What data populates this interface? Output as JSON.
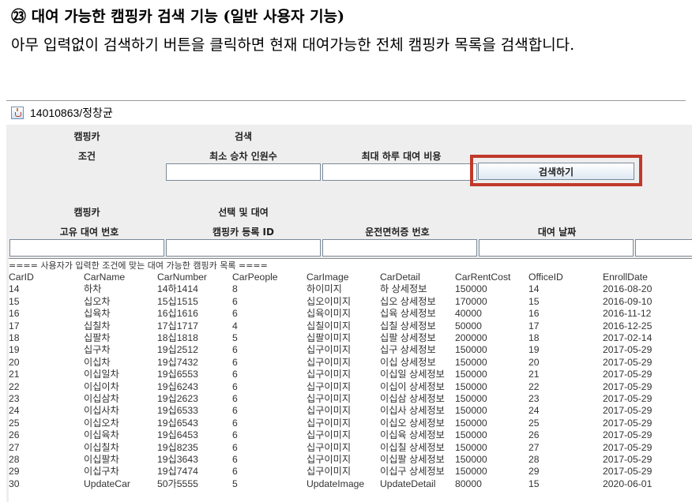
{
  "document": {
    "heading": "㉓ 대여 가능한 캠핑카 검색 기능 (일반 사용자 기능)",
    "paragraph": "아무 입력없이 검색하기 버튼을 클릭하면 현재 대여가능한 전체 캠핑카 목록을 검색합니다."
  },
  "window": {
    "title": "14010863/정창균",
    "icon": "java-cup-icon"
  },
  "search_section": {
    "label_campingcar": "캠핑카",
    "label_search": "검색",
    "label_condition": "조건",
    "label_min_people": "최소 승차 인원수",
    "label_max_cost": "최대 하루 대여 비용",
    "min_people_value": "",
    "max_cost_value": "",
    "search_button": "검색하기"
  },
  "rent_section": {
    "label_campingcar": "캠핑카",
    "label_select_rent": "선택 및 대여",
    "label_unique_no": "고유 대여 번호",
    "label_reg_id": "캠핑카 등록 ID",
    "label_license": "운전면허증 번호",
    "label_date": "대여 날짜"
  },
  "results": {
    "caption": "==== 사용자가 입력한 조건에 맞는 대여 가능한 캠핑카 목록 ====",
    "columns": [
      "CarID",
      "CarName",
      "CarNumber",
      "CarPeople",
      "CarImage",
      "CarDetail",
      "CarRentCost",
      "OfficeID",
      "EnrollDate"
    ],
    "rows": [
      [
        "14",
        "하차",
        "14하1414",
        "8",
        "하이미지",
        "하 상세정보",
        "150000",
        "14",
        "2016-08-20"
      ],
      [
        "15",
        "십오차",
        "15십1515",
        "6",
        "십오이미지",
        "십오 상세정보",
        "170000",
        "15",
        "2016-09-10"
      ],
      [
        "16",
        "십육차",
        "16십1616",
        "6",
        "십육이미지",
        "십육 상세정보",
        "40000",
        "16",
        "2016-11-12"
      ],
      [
        "17",
        "십칠차",
        "17십1717",
        "4",
        "십칠이미지",
        "십칠 상세정보",
        "50000",
        "17",
        "2016-12-25"
      ],
      [
        "18",
        "십팔차",
        "18십1818",
        "5",
        "십팔이미지",
        "십팔 상세정보",
        "200000",
        "18",
        "2017-02-14"
      ],
      [
        "19",
        "십구차",
        "19십2512",
        "6",
        "십구이미지",
        "십구 상세정보",
        "150000",
        "19",
        "2017-05-29"
      ],
      [
        "20",
        "이십차",
        "19십7432",
        "6",
        "십구이미지",
        "이십 상세정보",
        "150000",
        "20",
        "2017-05-29"
      ],
      [
        "21",
        "이십일차",
        "19십6553",
        "6",
        "십구이미지",
        "이십일 상세정보",
        "150000",
        "21",
        "2017-05-29"
      ],
      [
        "22",
        "이십이차",
        "19십6243",
        "6",
        "십구이미지",
        "이십이 상세정보",
        "150000",
        "22",
        "2017-05-29"
      ],
      [
        "23",
        "이십삼차",
        "19십2623",
        "6",
        "십구이미지",
        "이십삼 상세정보",
        "150000",
        "23",
        "2017-05-29"
      ],
      [
        "24",
        "이십사차",
        "19십6533",
        "6",
        "십구이미지",
        "이십사 상세정보",
        "150000",
        "24",
        "2017-05-29"
      ],
      [
        "25",
        "이십오차",
        "19십6543",
        "6",
        "십구이미지",
        "이십오 상세정보",
        "150000",
        "25",
        "2017-05-29"
      ],
      [
        "26",
        "이십육차",
        "19십6453",
        "6",
        "십구이미지",
        "이십육 상세정보",
        "150000",
        "26",
        "2017-05-29"
      ],
      [
        "27",
        "이십칠차",
        "19십8235",
        "6",
        "십구이미지",
        "이십칠 상세정보",
        "150000",
        "27",
        "2017-05-29"
      ],
      [
        "28",
        "이십팔차",
        "19십3643",
        "6",
        "십구이미지",
        "이십팔 상세정보",
        "150000",
        "28",
        "2017-05-29"
      ],
      [
        "29",
        "이십구차",
        "19십7474",
        "6",
        "십구이미지",
        "이십구 상세정보",
        "150000",
        "29",
        "2017-05-29"
      ],
      [
        "30",
        "UpdateCar",
        "50가5555",
        "5",
        "UpdateImage",
        "UpdateDetail",
        "80000",
        "15",
        "2020-06-01"
      ]
    ]
  },
  "colors": {
    "highlight": "#c0392b",
    "window_bg": "#eeeeee",
    "text": "#333333"
  }
}
